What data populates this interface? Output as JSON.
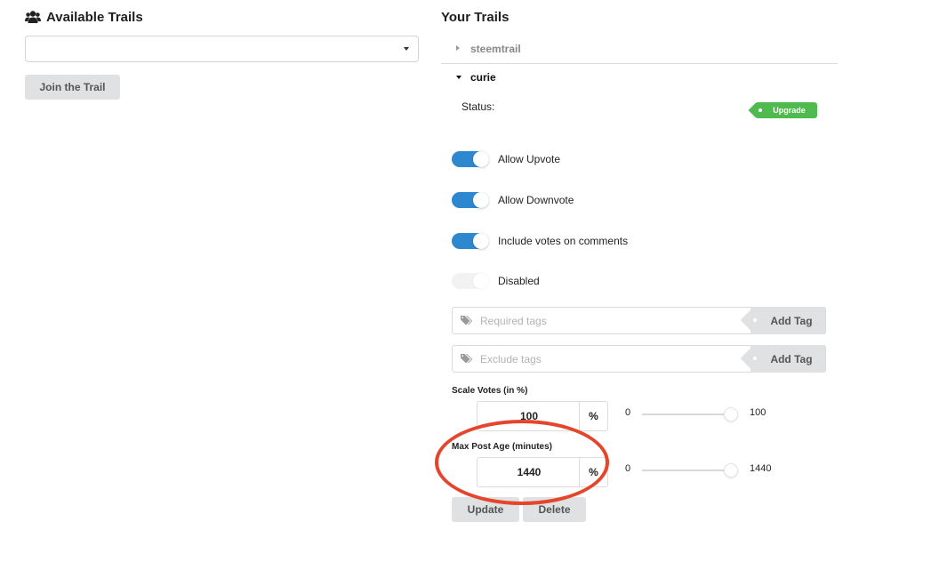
{
  "left": {
    "title": "Available Trails",
    "title_icon": "users-icon",
    "select_value": "",
    "join_button": "Join the Trail"
  },
  "right": {
    "title": "Your Trails",
    "trails": [
      {
        "name": "steemtrail",
        "expanded": false
      },
      {
        "name": "curie",
        "expanded": true
      }
    ],
    "status_label": "Status:",
    "status_badge": "Upgrade",
    "toggles": [
      {
        "label": "Allow Upvote",
        "on": true
      },
      {
        "label": "Allow Downvote",
        "on": true
      },
      {
        "label": "Include votes on comments",
        "on": true
      },
      {
        "label": "Disabled",
        "on": false
      }
    ],
    "required_tags": {
      "placeholder": "Required tags",
      "icon": "tags-icon",
      "button": "Add Tag"
    },
    "exclude_tags": {
      "placeholder": "Exclude tags",
      "icon": "tags-icon",
      "button": "Add Tag"
    },
    "scale_votes": {
      "label": "Scale Votes (in %)",
      "value": "100",
      "unit": "%",
      "min": "0",
      "max": "100",
      "slider_fraction": 1.0
    },
    "max_post_age": {
      "label": "Max Post Age (minutes)",
      "value": "1440",
      "unit": "%",
      "min": "0",
      "max": "1440",
      "slider_fraction": 1.0
    },
    "update_button": "Update",
    "delete_button": "Delete"
  },
  "colors": {
    "toggle_on": "#2d88d0",
    "badge": "#4fbb4e",
    "highlight_ellipse": "#e4452b",
    "button_grey": "#e0e1e2"
  }
}
